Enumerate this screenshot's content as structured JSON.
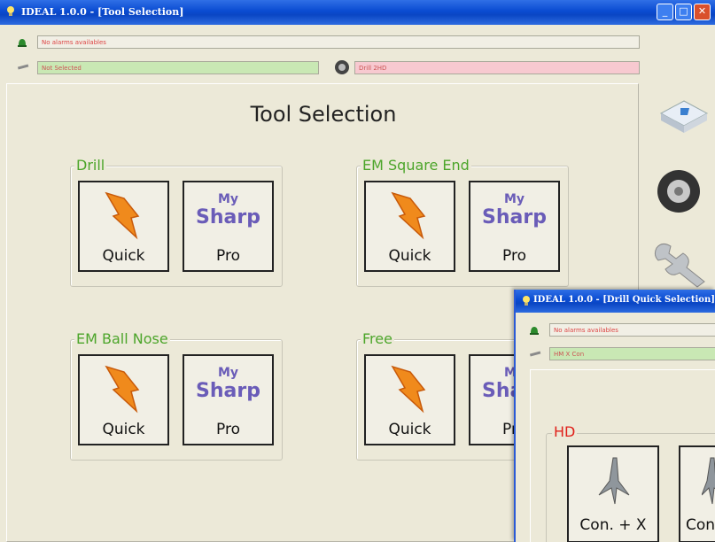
{
  "main_window": {
    "title": "IDEAL 1.0.0 - [Tool Selection]",
    "alarm_text": "No alarms availables",
    "tool_status": "Not Selected",
    "drill_status": "Drill 2HD",
    "heading": "Tool Selection",
    "groups": [
      {
        "name": "Drill",
        "quick_label": "Quick",
        "pro_label": "Pro"
      },
      {
        "name": "EM Square End",
        "quick_label": "Quick",
        "pro_label": "Pro"
      },
      {
        "name": "EM Ball Nose",
        "quick_label": "Quick",
        "pro_label": "Pro"
      },
      {
        "name": "Free",
        "quick_label": "Quick",
        "pro_label": "Pro"
      }
    ],
    "mysharp": {
      "line1": "My",
      "line2": "Sharp"
    },
    "sidebar_icons": [
      "keyboard-icon",
      "tire-icon",
      "wrench-icon"
    ]
  },
  "overlay_window": {
    "title": "IDEAL 1.0.0 - [Drill Quick Selection]",
    "alarm_text": "No alarms availables",
    "tool_status": "HM X Con",
    "group_label": "HD",
    "buttons": [
      "Con. + X",
      "Con"
    ]
  },
  "colors": {
    "titlebar": "#0a4bd1",
    "window_bg": "#ece9d8",
    "group_label": "#4ca52a",
    "hd_label": "#e0201a",
    "status_green": "#c9e8b4",
    "status_pink": "#f7c9d0",
    "mysharp_purple": "#6a5cb8"
  }
}
